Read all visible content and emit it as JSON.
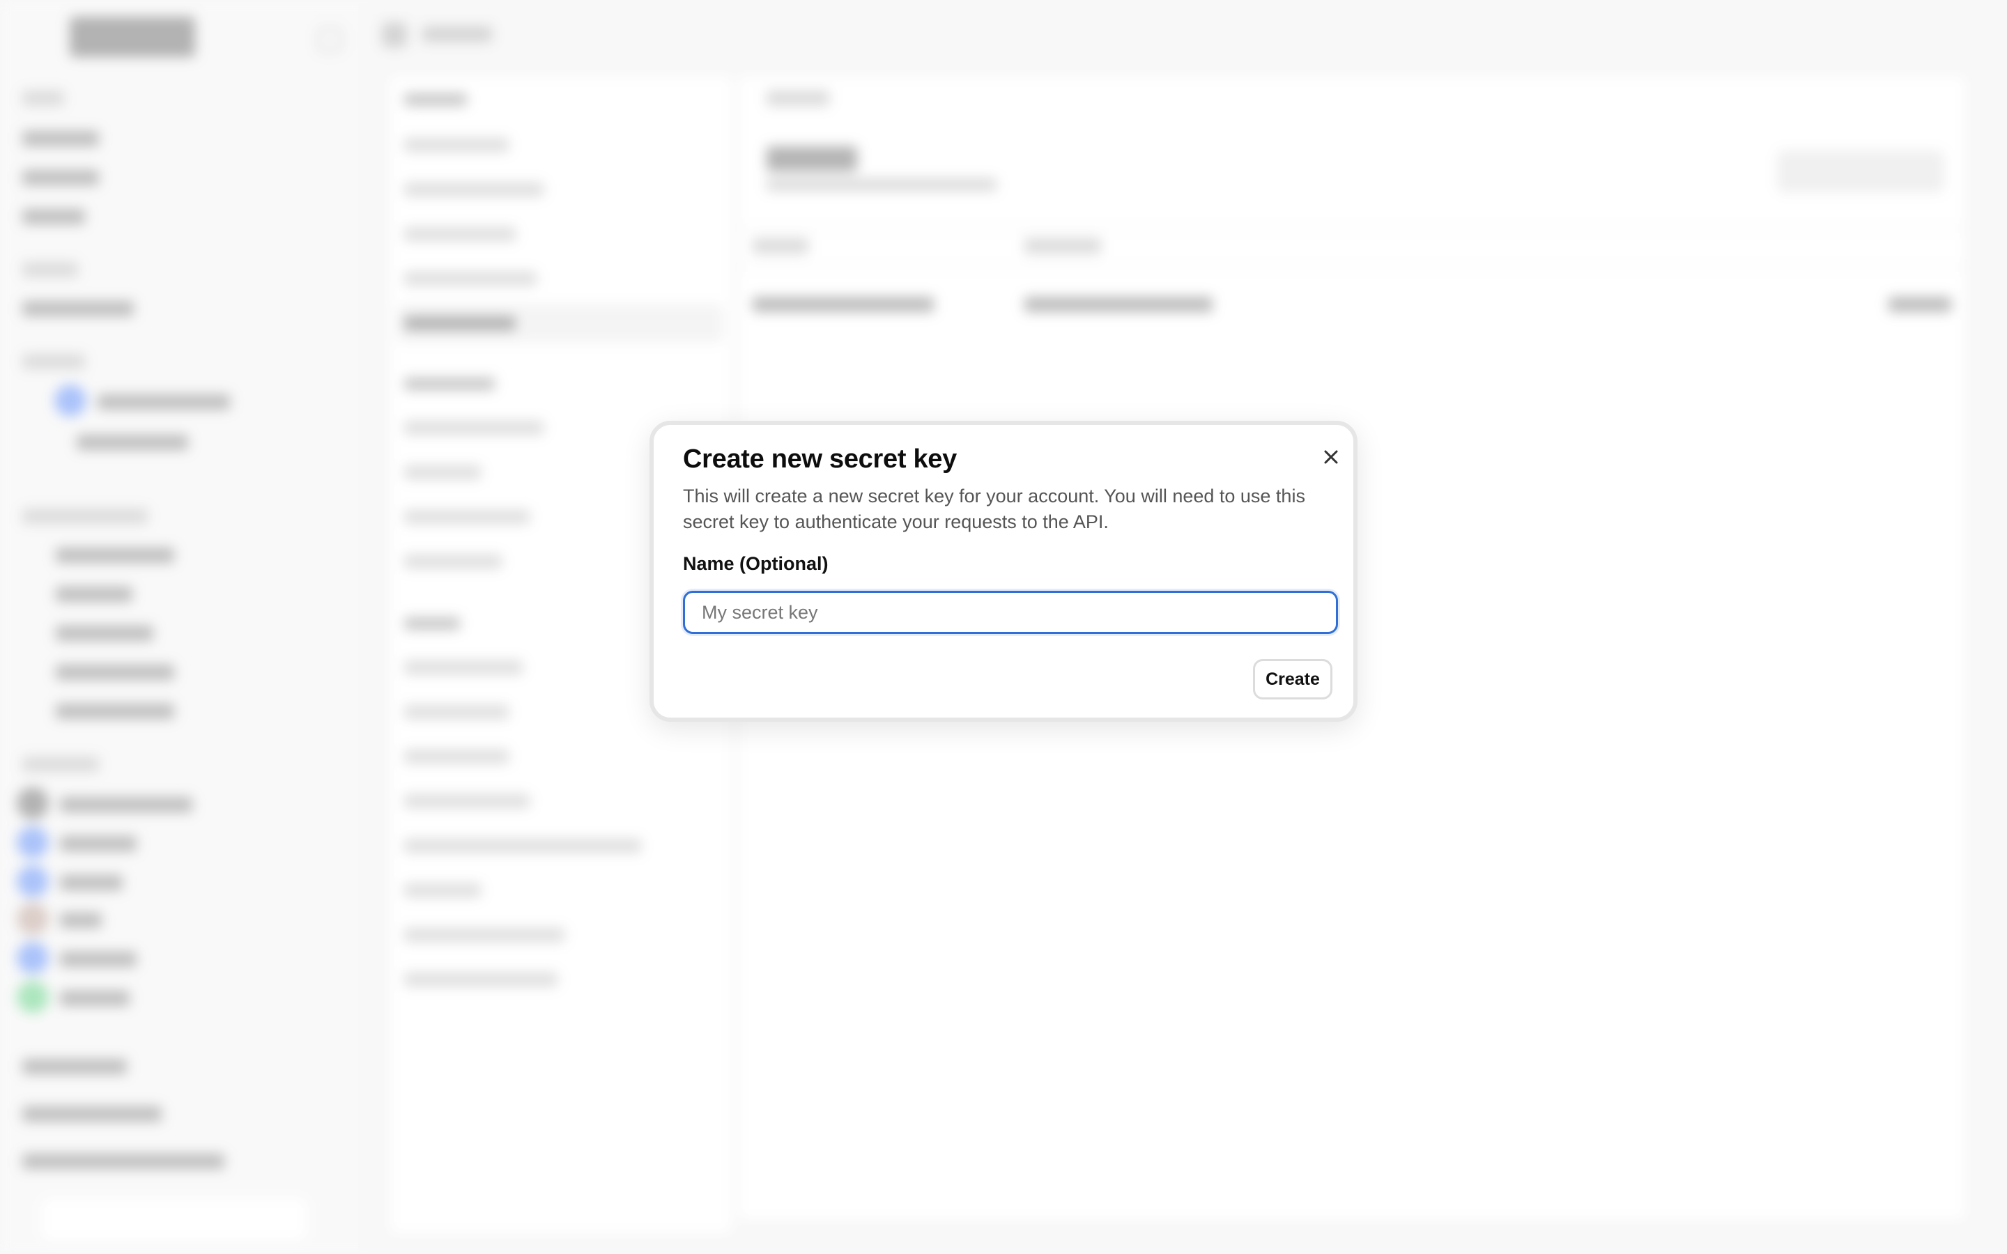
{
  "dialog": {
    "title": "Create new secret key",
    "description": "This will create a new secret key for your account. You will need to use this secret key to authenticate your requests to the API.",
    "name_label": "Name (Optional)",
    "name_input": {
      "value": "",
      "placeholder": "My secret key"
    },
    "create_label": "Create",
    "close_icon": "close-icon"
  },
  "colors": {
    "focus_ring": "#2f6fd6",
    "dialog_bg": "#ffffff",
    "backdrop": "#f4f4f4"
  }
}
